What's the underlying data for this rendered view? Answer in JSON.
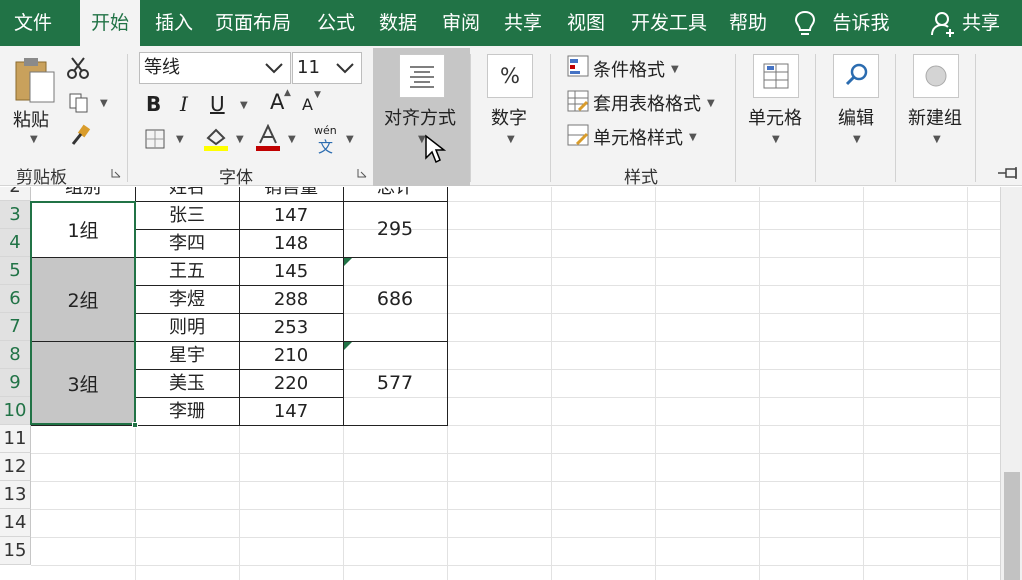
{
  "tabs": {
    "file": "文件",
    "home": "开始",
    "insert": "插入",
    "page_layout": "页面布局",
    "formulas": "公式",
    "data": "数据",
    "review": "审阅",
    "share_tab": "共享",
    "view": "视图",
    "developer": "开发工具",
    "help": "帮助",
    "tell_me": "告诉我",
    "share": "共享",
    "active": "开始"
  },
  "ribbon": {
    "clipboard": {
      "paste": "粘贴",
      "group": "剪贴板"
    },
    "font": {
      "font_name": "等线",
      "font_size": "11",
      "bold": "B",
      "italic": "I",
      "underline": "U",
      "grow": "A",
      "shrink": "A",
      "phonetic_top": "wén",
      "phonetic_bottom": "文",
      "group": "字体",
      "highlight_color": "#ffff00",
      "font_color": "#c00000"
    },
    "alignment": {
      "label": "对齐方式"
    },
    "number": {
      "symbol": "%",
      "label": "数字"
    },
    "styles": {
      "conditional": "条件格式",
      "table_format": "套用表格格式",
      "cell_styles": "单元格样式",
      "group": "样式"
    },
    "cells": {
      "label": "单元格"
    },
    "editing": {
      "label": "编辑"
    },
    "new_group": {
      "label": "新建组"
    }
  },
  "sheet": {
    "row_numbers": [
      "2",
      "3",
      "4",
      "5",
      "6",
      "7",
      "8",
      "9",
      "10",
      "11",
      "12",
      "13",
      "14",
      "15"
    ],
    "selected_rows": [
      "3",
      "4",
      "5",
      "6",
      "7",
      "8",
      "9",
      "10"
    ],
    "header_row_partial": [
      "组别",
      "姓名",
      "销售量",
      "总计"
    ],
    "groups": [
      {
        "group": "1组",
        "members": [
          {
            "name": "张三",
            "sales": "147"
          },
          {
            "name": "李四",
            "sales": "148"
          }
        ],
        "total": "295"
      },
      {
        "group": "2组",
        "members": [
          {
            "name": "王五",
            "sales": "145"
          },
          {
            "name": "李煜",
            "sales": "288"
          },
          {
            "name": "则明",
            "sales": "253"
          }
        ],
        "total": "686"
      },
      {
        "group": "3组",
        "members": [
          {
            "name": "星宇",
            "sales": "210"
          },
          {
            "name": "美玉",
            "sales": "220"
          },
          {
            "name": "李珊",
            "sales": "147"
          }
        ],
        "total": "577"
      }
    ]
  },
  "colors": {
    "brand": "#217346",
    "ribbon_bg": "#f3f3f3",
    "selected_fill": "#c6c6c6"
  }
}
